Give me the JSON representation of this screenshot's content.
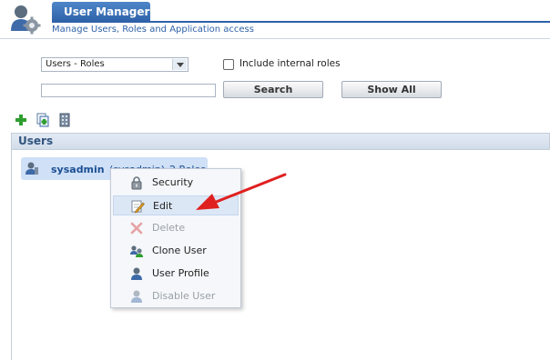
{
  "header": {
    "title": "User Manager",
    "subtitle": "Manage Users, Roles and Application access",
    "icon": "user-gear-icon"
  },
  "filters": {
    "view_select": {
      "value": "Users - Roles"
    },
    "include_internal_roles": {
      "label": "Include internal roles",
      "checked": false
    },
    "search_input": {
      "value": "",
      "placeholder": ""
    },
    "search_button": "Search",
    "show_all_button": "Show All"
  },
  "toolbar": {
    "icons": [
      "add-icon",
      "copy-icon",
      "building-icon"
    ]
  },
  "users_panel": {
    "title": "Users",
    "items": [
      {
        "name": "sysadmin",
        "login": "(sysadmin)",
        "roles": "2 Roles",
        "icon": "user-icon"
      }
    ]
  },
  "context_menu": {
    "items": [
      {
        "label": "Security",
        "icon": "lock-icon",
        "enabled": true
      },
      {
        "label": "Edit",
        "icon": "edit-icon",
        "enabled": true,
        "highlighted": true
      },
      {
        "label": "Delete",
        "icon": "delete-icon",
        "enabled": false
      },
      {
        "label": "Clone User",
        "icon": "clone-user-icon",
        "enabled": true
      },
      {
        "label": "User Profile",
        "icon": "user-profile-icon",
        "enabled": true
      },
      {
        "label": "Disable User",
        "icon": "disable-user-icon",
        "enabled": false
      }
    ]
  },
  "colors": {
    "brand": "#2f62a8",
    "selection": "#cfe0f7",
    "annotation_arrow": "#e02020"
  }
}
